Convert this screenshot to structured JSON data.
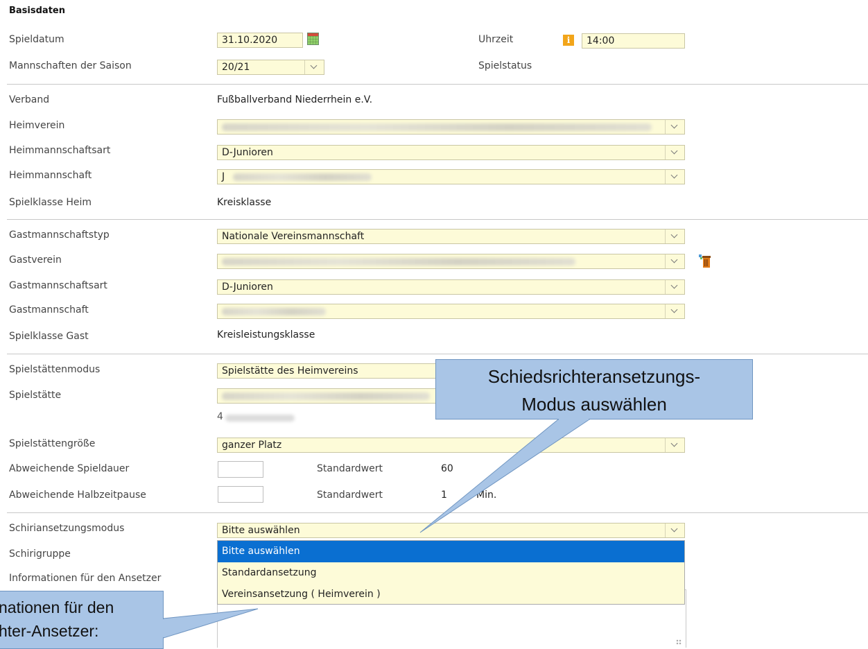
{
  "section_title": "Basisdaten",
  "fields": {
    "spieldatum": {
      "label": "Spieldatum",
      "value": "31.10.2020"
    },
    "uhrzeit": {
      "label": "Uhrzeit",
      "value": "14:00"
    },
    "mannschaften_saison": {
      "label": "Mannschaften der Saison",
      "value": "20/21"
    },
    "spielstatus": {
      "label": "Spielstatus"
    },
    "verband": {
      "label": "Verband",
      "value": "Fußballverband Niederrhein e.V."
    },
    "heimverein": {
      "label": "Heimverein"
    },
    "heimmannschaftsart": {
      "label": "Heimmannschaftsart",
      "value": "D-Junioren"
    },
    "heimmannschaft": {
      "label": "Heimmannschaft",
      "value": "J"
    },
    "spielklasse_heim": {
      "label": "Spielklasse Heim",
      "value": "Kreisklasse"
    },
    "gastmannschaftstyp": {
      "label": "Gastmannschaftstyp",
      "value": "Nationale Vereinsmannschaft"
    },
    "gastverein": {
      "label": "Gastverein"
    },
    "gastmannschaftsart": {
      "label": "Gastmannschaftsart",
      "value": "D-Junioren"
    },
    "gastmannschaft": {
      "label": "Gastmannschaft"
    },
    "spielklasse_gast": {
      "label": "Spielklasse Gast",
      "value": "Kreisleistungsklasse"
    },
    "spielstaettenmodus": {
      "label": "Spielstättenmodus",
      "value": "Spielstätte des Heimvereins"
    },
    "spielstaette": {
      "label": "Spielstätte",
      "value2": "4"
    },
    "spielstaettengroesse": {
      "label": "Spielstättengröße",
      "value": "ganzer Platz"
    },
    "abw_spieldauer": {
      "label": "Abweichende Spieldauer",
      "std_label": "Standardwert",
      "std_value": "60"
    },
    "abw_halbzeitpause": {
      "label": "Abweichende Halbzeitpause",
      "std_label": "Standardwert",
      "std_value": "1",
      "std_unit": "Min."
    },
    "schiriansetzungsmodus": {
      "label": "Schiriansetzungsmodus",
      "value": "Bitte auswählen"
    },
    "schirigruppe": {
      "label": "Schirigruppe"
    },
    "info_ansetzer": {
      "label": "Informationen für den Ansetzer"
    }
  },
  "dropdown_options": [
    "Bitte auswählen",
    "Standardansetzung",
    "Vereinsansetzung ( Heimverein )"
  ],
  "callouts": {
    "top_line1": "Schiedsrichteransetzungs-",
    "top_line2": "Modus auswählen",
    "bottom_line1": "nationen für den",
    "bottom_line2": "hter-Ansetzer:"
  },
  "colors": {
    "input_bg": "#fdfbd8",
    "selected_option": "#0a6fd1",
    "callout_bg": "#a9c5e6"
  }
}
